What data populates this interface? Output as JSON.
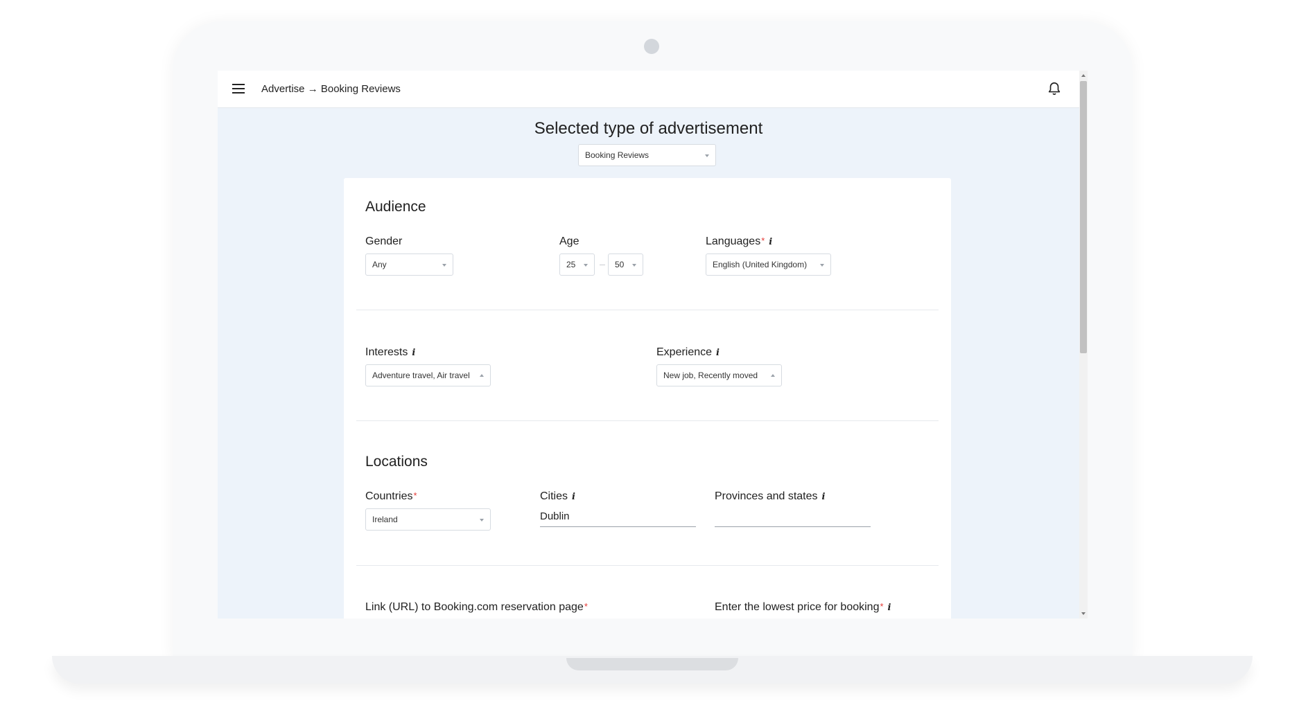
{
  "topbar": {
    "breadcrumb": "Advertise → Booking Reviews"
  },
  "page": {
    "title": "Selected type of advertisement",
    "ad_type": "Booking Reviews"
  },
  "audience": {
    "title": "Audience",
    "gender_label": "Gender",
    "gender_value": "Any",
    "age_label": "Age",
    "age_min": "25",
    "age_max": "50",
    "languages_label": "Languages",
    "languages_value": "English (United Kingdom)",
    "interests_label": "Interests",
    "interests_value": "Adventure travel, Air travel",
    "experience_label": "Experience",
    "experience_value": "New job, Recently moved"
  },
  "locations": {
    "title": "Locations",
    "countries_label": "Countries",
    "countries_value": "Ireland",
    "cities_label": "Cities",
    "cities_value": "Dublin",
    "provinces_label": "Provinces and states",
    "provinces_value": ""
  },
  "booking": {
    "link_label": "Link (URL) to Booking.com reservation page",
    "price_label": "Enter the lowest price for booking"
  },
  "common": {
    "required_mark": "*",
    "info_mark": "i"
  },
  "colors": {
    "screen_bg": "#edf3fa",
    "required": "#e53935"
  }
}
